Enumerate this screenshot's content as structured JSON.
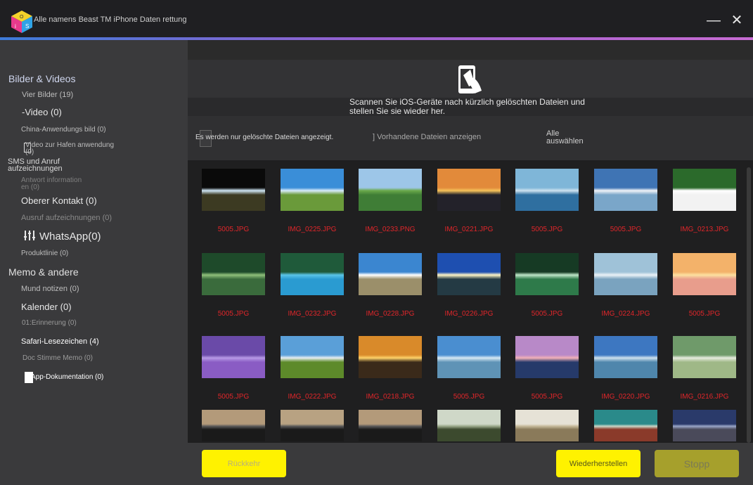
{
  "window": {
    "title": "Alle namens Beast TM iPhone Daten rettung",
    "minimize_glyph": "—",
    "close_glyph": "✕",
    "logo_icon": "ios-cube-logo"
  },
  "sidebar": {
    "cat_photos": "Bilder & Videos",
    "photos": "Vier Bilder (19)",
    "video": "-Video (0)",
    "china_app": "China-Anwendungs bild (0)",
    "video_port": "Video zur Hafen anwendung (0)",
    "cat_sms": "SMS und Anruf aufzeichnungen",
    "answer_info": "Antwort information en (0)",
    "top_contact": "Oberer Kontakt (0)",
    "call_records": "Ausruf aufzeichnungen (0)",
    "whatsapp": "WhatsApp(0)",
    "product_line": "Produktlinie (0)",
    "cat_memo": "Memo & andere",
    "notes": "Mund notizen (0)",
    "calendar": "Kalender (0)",
    "reminder": "01:Erinnerung (0)",
    "safari": "Safari-Lesezeichen (4)",
    "voice_memo": "Doc Stimme Memo (0)",
    "app_docs": "App-Dokumentation (0)"
  },
  "header": {
    "icon": "phone-scan-icon",
    "scan_text": "Scannen Sie iOS-Geräte nach kürzlich gelöschten Dateien und stellen Sie sie wieder her."
  },
  "filter": {
    "deleted_only": "Es werden nur gelöschte Dateien angezeigt.",
    "show_existing": "] Vorhandene Dateien anzeigen",
    "select_all": "Alle auswählen"
  },
  "thumbnails": [
    {
      "label": "5005.JPG",
      "sky": "#0a0a0a",
      "ground": "#3c3a22",
      "accent": "#cfe6f4"
    },
    {
      "label": "IMG_0225.JPG",
      "sky": "#3a8ed8",
      "ground": "#6a9a3a",
      "accent": "#d9ecfa"
    },
    {
      "label": "IMG_0233.PNG",
      "sky": "#9dc6e8",
      "ground": "#3f7d36",
      "accent": "#6aa94a"
    },
    {
      "label": "IMG_0221.JPG",
      "sky": "#e28a3a",
      "ground": "#23222a",
      "accent": "#f6c35a"
    },
    {
      "label": "5005.JPG",
      "sky": "#7fb6d8",
      "ground": "#2f6fa0",
      "accent": "#cfe3f0"
    },
    {
      "label": "5005.JPG",
      "sky": "#3f74b4",
      "ground": "#7aa6c9",
      "accent": "#f1f4f8"
    },
    {
      "label": "IMG_0213.JPG",
      "sky": "#2b6a2b",
      "ground": "#f2f2f2",
      "accent": "#ffffff"
    },
    {
      "label": "5005.JPG",
      "sky": "#1e4a2a",
      "ground": "#3a6b3c",
      "accent": "#8fbf7a"
    },
    {
      "label": "IMG_0232.JPG",
      "sky": "#1f5a3a",
      "ground": "#2a9bd1",
      "accent": "#5bc4e6"
    },
    {
      "label": "IMG_0228.JPG",
      "sky": "#3b86d0",
      "ground": "#9b8f6a",
      "accent": "#ffffff"
    },
    {
      "label": "IMG_0226.JPG",
      "sky": "#1e4fb0",
      "ground": "#243a44",
      "accent": "#fff6c8"
    },
    {
      "label": "5005.JPG",
      "sky": "#163a24",
      "ground": "#2e7a4a",
      "accent": "#bfe6c8"
    },
    {
      "label": "IMG_0224.JPG",
      "sky": "#9fc2d8",
      "ground": "#7aa3bf",
      "accent": "#eaf2f7"
    },
    {
      "label": "5005.JPG",
      "sky": "#f3b26a",
      "ground": "#e89d8c",
      "accent": "#fde0a0"
    },
    {
      "label": "5005.JPG",
      "sky": "#6a4aa8",
      "ground": "#8a5cc4",
      "accent": "#b79ae6"
    },
    {
      "label": "IMG_0222.JPG",
      "sky": "#5a9fd8",
      "ground": "#5d8a2a",
      "accent": "#e8eef2"
    },
    {
      "label": "IMG_0218.JPG",
      "sky": "#d98a2a",
      "ground": "#3a2a1a",
      "accent": "#ffd26a"
    },
    {
      "label": "5005.JPG",
      "sky": "#4a8ed0",
      "ground": "#5f93b6",
      "accent": "#d7e9f4"
    },
    {
      "label": "5005.JPG",
      "sky": "#b889c8",
      "ground": "#263a6a",
      "accent": "#f2b0b8"
    },
    {
      "label": "IMG_0220.JPG",
      "sky": "#3d77c1",
      "ground": "#4f86ac",
      "accent": "#cfe0ee"
    },
    {
      "label": "IMG_0216.JPG",
      "sky": "#6f9a6a",
      "ground": "#9fb887",
      "accent": "#e7ecdf"
    },
    {
      "label": "",
      "sky": "#b39a7a",
      "ground": "#1a1a1a",
      "accent": "#5a5a5a"
    },
    {
      "label": "",
      "sky": "#b8a282",
      "ground": "#1a1a1a",
      "accent": "#5a5a5a"
    },
    {
      "label": "",
      "sky": "#b39a7a",
      "ground": "#1a1a1a",
      "accent": "#5a5a5a"
    },
    {
      "label": "",
      "sky": "#cfd8c8",
      "ground": "#3c4a2e",
      "accent": "#9aa88a"
    },
    {
      "label": "",
      "sky": "#e6e2d6",
      "ground": "#8a7a5a",
      "accent": "#c6b99a"
    },
    {
      "label": "",
      "sky": "#2a8a8a",
      "ground": "#8a3a2a",
      "accent": "#c8d8c8"
    },
    {
      "label": "",
      "sky": "#2a3a6a",
      "ground": "#4a4a5a",
      "accent": "#9aa6c8"
    }
  ],
  "buttons": {
    "back": "Rückkehr",
    "restore": "Wiederherstellen",
    "stop": "Stopp"
  }
}
